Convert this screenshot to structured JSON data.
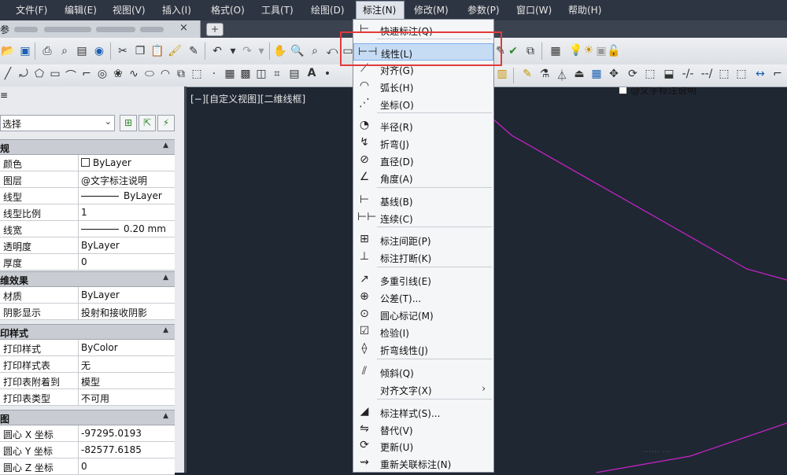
{
  "menubar": {
    "items": [
      "文件(F)",
      "编辑(E)",
      "视图(V)",
      "插入(I)",
      "格式(O)",
      "工具(T)",
      "绘图(D)",
      "标注(N)",
      "修改(M)",
      "参数(P)",
      "窗口(W)",
      "帮助(H)"
    ],
    "active": "标注(N)"
  },
  "tab": {
    "prefix": "参",
    "close": "×",
    "new_tab": "+"
  },
  "toolbar": {
    "layer_name": "@文字标注说明"
  },
  "viewport_label": "[−][自定义视图][二维线框]",
  "properties": {
    "select_value": "选择",
    "sections": [
      {
        "title": "规",
        "rows": [
          {
            "key": "颜色",
            "value": "ByLayer"
          },
          {
            "key": "图层",
            "value": "@文字标注说明"
          },
          {
            "key": "线型",
            "value": "ByLayer"
          },
          {
            "key": "线型比例",
            "value": "1"
          },
          {
            "key": "线宽",
            "value": "0.20 mm"
          },
          {
            "key": "透明度",
            "value": "ByLayer"
          },
          {
            "key": "厚度",
            "value": "0"
          }
        ]
      },
      {
        "title": "维效果",
        "rows": [
          {
            "key": "材质",
            "value": "ByLayer"
          },
          {
            "key": "阴影显示",
            "value": "投射和接收阴影"
          }
        ]
      },
      {
        "title": "印样式",
        "rows": [
          {
            "key": "打印样式",
            "value": "ByColor"
          },
          {
            "key": "打印样式表",
            "value": "无"
          },
          {
            "key": "打印表附着到",
            "value": "模型"
          },
          {
            "key": "打印表类型",
            "value": "不可用"
          }
        ]
      },
      {
        "title": "图",
        "rows": [
          {
            "key": "圆心 X 坐标",
            "value": "-97295.0193"
          },
          {
            "key": "圆心 Y 坐标",
            "value": "-82577.6185"
          },
          {
            "key": "圆心 Z 坐标",
            "value": "0"
          }
        ]
      }
    ]
  },
  "dimension_menu": {
    "items": [
      {
        "label": "快速标注(Q)",
        "icon": "quick-dimension-icon"
      },
      {
        "label": "线性(L)",
        "icon": "linear-dimension-icon",
        "highlighted": true
      },
      {
        "label": "对齐(G)",
        "icon": "aligned-dimension-icon"
      },
      {
        "label": "弧长(H)",
        "icon": "arc-length-icon"
      },
      {
        "label": "坐标(O)",
        "icon": "ordinate-icon"
      },
      {
        "label": "半径(R)",
        "icon": "radius-icon"
      },
      {
        "label": "折弯(J)",
        "icon": "jogged-icon"
      },
      {
        "label": "直径(D)",
        "icon": "diameter-icon"
      },
      {
        "label": "角度(A)",
        "icon": "angular-icon"
      },
      {
        "label": "基线(B)",
        "icon": "baseline-icon"
      },
      {
        "label": "连续(C)",
        "icon": "continue-icon"
      },
      {
        "label": "标注间距(P)",
        "icon": "dim-space-icon"
      },
      {
        "label": "标注打断(K)",
        "icon": "dim-break-icon"
      },
      {
        "label": "多重引线(E)",
        "icon": "multileader-icon"
      },
      {
        "label": "公差(T)...",
        "icon": "tolerance-icon"
      },
      {
        "label": "圆心标记(M)",
        "icon": "center-mark-icon"
      },
      {
        "label": "检验(I)",
        "icon": "inspection-icon"
      },
      {
        "label": "折弯线性(J)",
        "icon": "jogged-linear-icon"
      },
      {
        "label": "倾斜(Q)",
        "icon": "oblique-icon"
      },
      {
        "label": "对齐文字(X)",
        "icon": "",
        "submenu": true
      },
      {
        "label": "标注样式(S)...",
        "icon": "dim-style-icon"
      },
      {
        "label": "替代(V)",
        "icon": "override-icon"
      },
      {
        "label": "更新(U)",
        "icon": "update-icon"
      },
      {
        "label": "重新关联标注(N)",
        "icon": "reassociate-icon"
      }
    ]
  },
  "colors": {
    "accent_line": "#cc22cc",
    "highlight": "#c6dcf5",
    "callout": "#e23a3a"
  }
}
